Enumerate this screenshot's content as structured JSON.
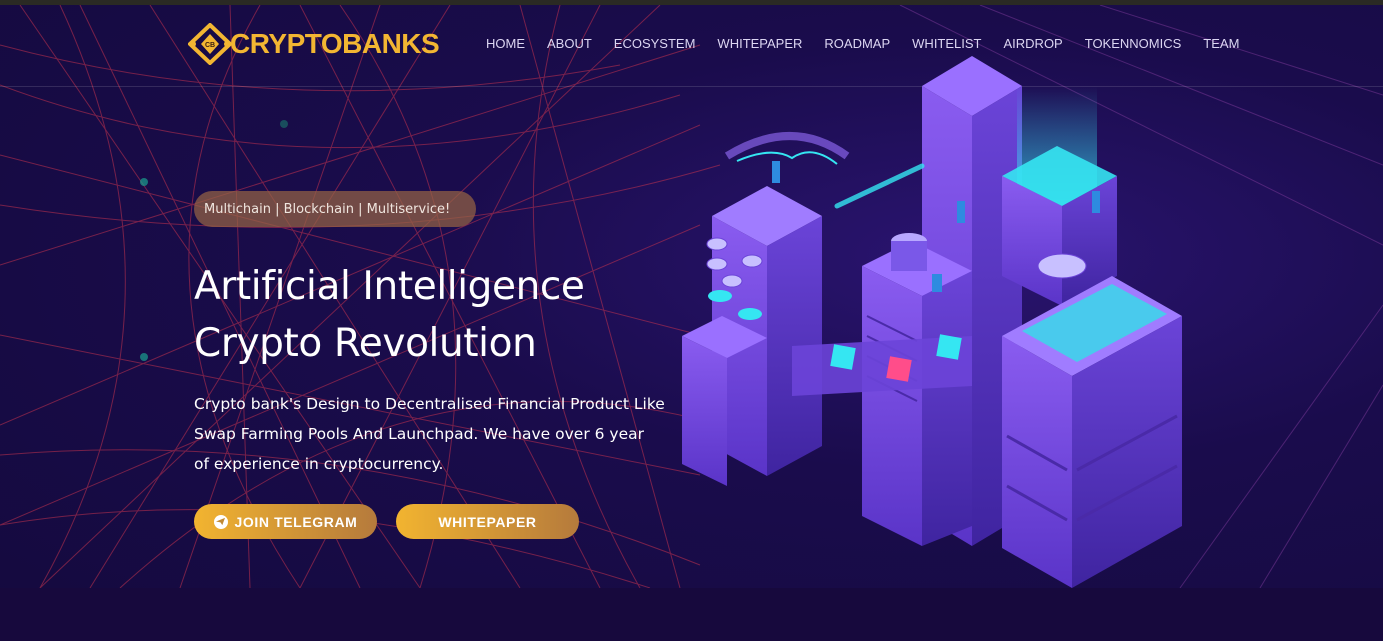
{
  "brand": {
    "name": "CRYPTOBANKS",
    "mark_letters": "CB",
    "color_gold": "#f2b632"
  },
  "nav": {
    "items": [
      "HOME",
      "ABOUT",
      "ECOSYSTEM",
      "WHITEPAPER",
      "ROADMAP",
      "WHITELIST",
      "AIRDROP",
      "TOKENNOMICS",
      "TEAM"
    ]
  },
  "hero": {
    "tagline": "Multichain | Blockchain | Multiservice!",
    "headline_line1": "Artificial Intelligence",
    "headline_line2": "Crypto Revolution",
    "desc_line1": "Crypto bank's Design to Decentralised Financial Product Like",
    "desc_line2": "Swap Farming Pools And Launchpad. We have over 6 year",
    "desc_line3": "of experience in cryptocurrency.",
    "btn_telegram": "JOIN TELEGRAM",
    "btn_whitepaper": "WHITEPAPER"
  },
  "icons": {
    "telegram": "telegram-icon",
    "logo": "cryptobanks-logo-icon",
    "illustration": "isometric-datacenter-illustration"
  },
  "colors": {
    "background": "#140a3e",
    "accent_gold": "#f2b430",
    "accent_brown": "#b57a3c",
    "building_purple": "#7a4ee6",
    "glow_cyan": "#35e6f2"
  }
}
